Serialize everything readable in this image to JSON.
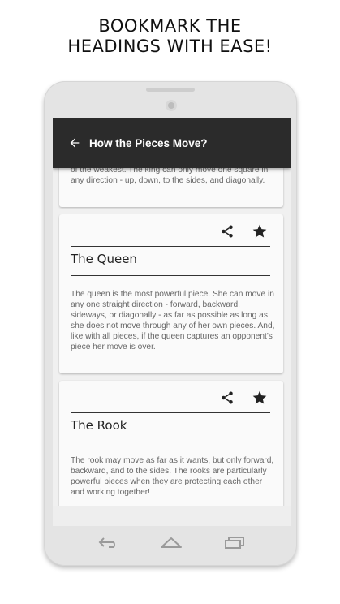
{
  "promo": {
    "line1": "BOOKMARK THE",
    "line2": "HEADINGS WITH EASE!"
  },
  "appbar": {
    "back_icon": "arrow-left-icon",
    "title": "How the Pieces Move?"
  },
  "cards": [
    {
      "body": "of the weakest. The king can only move one square in any direction - up, down, to the sides, and diagonally."
    },
    {
      "heading": "The Queen",
      "body": "The queen is the most powerful piece. She can move in any one straight direction - forward, backward, sideways, or diagonally - as far as possible as long as she does not move through any of her own pieces. And, like with all pieces, if the queen captures an opponent's piece her move is over.",
      "share_icon": "share-icon",
      "bookmark_icon": "star-icon"
    },
    {
      "heading": "The Rook",
      "body": "The rook may move as far as it wants, but only forward, backward, and to the sides. The rooks are particularly powerful pieces when they are protecting each other and working together!",
      "share_icon": "share-icon",
      "bookmark_icon": "star-icon"
    }
  ],
  "navbar": {
    "back_icon": "nav-back-icon",
    "home_icon": "nav-home-icon",
    "recents_icon": "nav-recents-icon"
  },
  "colors": {
    "appbar": "#2b2b2b",
    "screen_bg": "#f0f0f0",
    "card_bg": "#fafafa"
  }
}
